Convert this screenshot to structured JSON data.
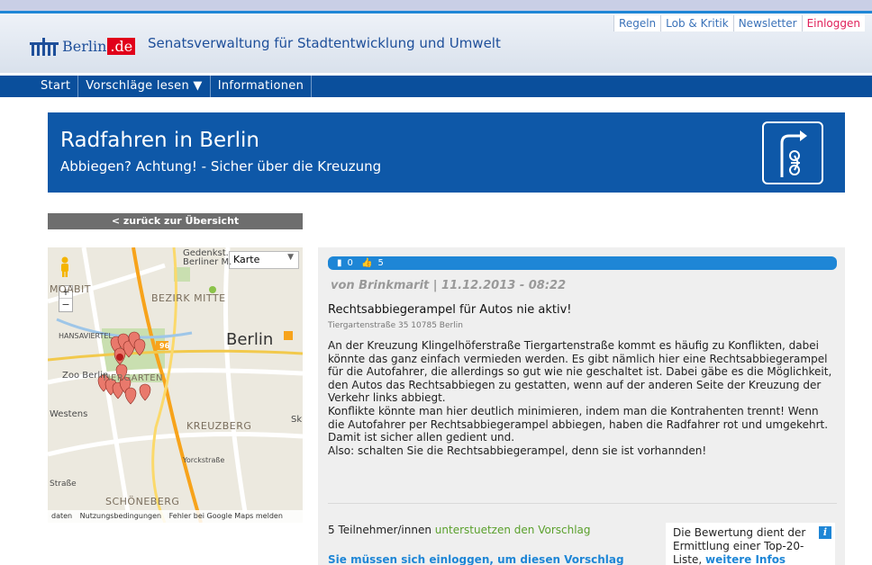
{
  "header": {
    "logo_text": "Berlin",
    "logo_domain": ".de",
    "site_title": "Senatsverwaltung für Stadtentwicklung und Umwelt",
    "top_links": [
      "Regeln",
      "Lob & Kritik",
      "Newsletter",
      "Einloggen"
    ]
  },
  "nav": {
    "items": [
      "Start",
      "Vorschläge lesen ▼",
      "Informationen"
    ]
  },
  "hero": {
    "title": "Radfahren in Berlin",
    "subtitle": "Abbiegen? Achtung! - Sicher über die Kreuzung"
  },
  "back_label": "< zurück zur Übersicht",
  "map": {
    "type_label": "Karte",
    "zoom_in": "+",
    "zoom_out": "−",
    "labels": [
      "Gedenkst. Berliner M.",
      "MOABIT",
      "BEZIRK MITTE",
      "HANSAVIERTEL",
      "TIERGARTEN",
      "Berlin",
      "Zoo Berlin",
      "Westens",
      "KREUZBERG",
      "SCHÖNEBERG",
      "Yorckstraße",
      "Straße",
      "Sk"
    ],
    "road_number": "96",
    "footer": [
      "daten",
      "Nutzungsbedingungen",
      "Fehler bei Google Maps melden"
    ]
  },
  "post": {
    "comments": "0",
    "likes": "5",
    "author_line": "von Brinkmarit | 11.12.2013 - 08:22",
    "title": "Rechtsabbiegerampel für Autos nie aktiv!",
    "address": "Tiergartenstraße 35 10785 Berlin",
    "body": [
      "An der Kreuzung Klingelhöferstraße Tiergartenstraße kommt es häufig zu Konflikten, dabei könnte das ganz einfach vermieden werden. Es gibt nämlich hier eine Rechtsabbiegerampel für die Autofahrer, die allerdings so gut wie nie geschaltet ist. Dabei gäbe es die Möglichkeit, den Autos das Rechtsabbiegen zu gestatten, wenn auf der anderen Seite der Kreuzung der Verkehr links abbiegt.",
      "Konflikte könnte man hier deutlich minimieren, indem man die Kontrahenten trennt! Wenn die Autofahrer per Rechtsabbiegerampel abbiegen, haben die Radfahrer rot und umgekehrt. Damit ist sicher allen gedient und.",
      "Also: schalten Sie die Rechtsabbiegerampel, denn sie ist vorhannden!"
    ],
    "participants_prefix": "5 Teilnehmer/innen",
    "participants_link": "unterstuetzen den Vorschlag",
    "login_hint": "Sie müssen sich einloggen, um diesen Vorschlag bewerten zu können",
    "info_text": "Die Bewertung dient der Ermittlung einer Top-20-Liste,",
    "info_link": "weitere Infos dazu hier"
  },
  "colors": {
    "primary": "#0e58a8",
    "nav": "#0a4f9c",
    "accent": "#1e86d6",
    "login": "#e0205a",
    "support_green": "#5aa02c"
  }
}
